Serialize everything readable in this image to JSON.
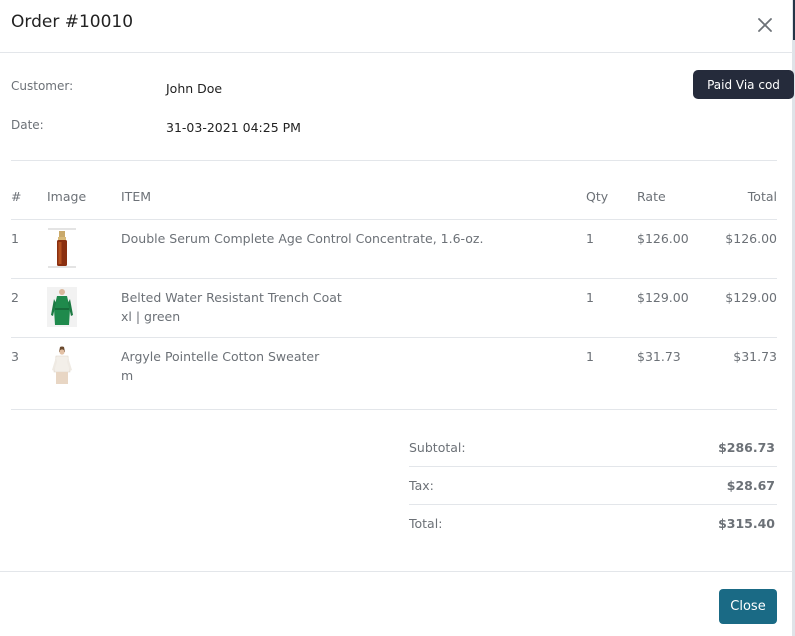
{
  "modal": {
    "title": "Order #10010",
    "close_button_label": "Close"
  },
  "tooltip": {
    "text": "Paid Via cod"
  },
  "customer": {
    "customer_label": "Customer:",
    "customer_value": "John Doe",
    "date_label": "Date:",
    "date_value": "31-03-2021 04:25 PM"
  },
  "table": {
    "headers": {
      "index": "#",
      "image": "Image",
      "item": "ITEM",
      "qty": "Qty",
      "rate": "Rate",
      "total": "Total"
    },
    "rows": [
      {
        "index": "1",
        "name": "Double Serum Complete Age Control Concentrate, 1.6-oz.",
        "variant": "",
        "qty": "1",
        "rate": "$126.00",
        "total": "$126.00",
        "image_icon": "serum-bottle-icon"
      },
      {
        "index": "2",
        "name": "Belted Water Resistant Trench Coat",
        "variant": "xl | green",
        "qty": "1",
        "rate": "$129.00",
        "total": "$129.00",
        "image_icon": "trench-coat-icon"
      },
      {
        "index": "3",
        "name": "Argyle Pointelle Cotton Sweater",
        "variant": "m",
        "qty": "1",
        "rate": "$31.73",
        "total": "$31.73",
        "image_icon": "sweater-icon"
      }
    ]
  },
  "summary": {
    "subtotal_label": "Subtotal:",
    "subtotal_value": "$286.73",
    "tax_label": "Tax:",
    "tax_value": "$28.67",
    "total_label": "Total:",
    "total_value": "$315.40"
  },
  "colors": {
    "accent": "#1a6a85",
    "tooltip_bg": "#252b3b",
    "muted_text": "#6c7177"
  }
}
